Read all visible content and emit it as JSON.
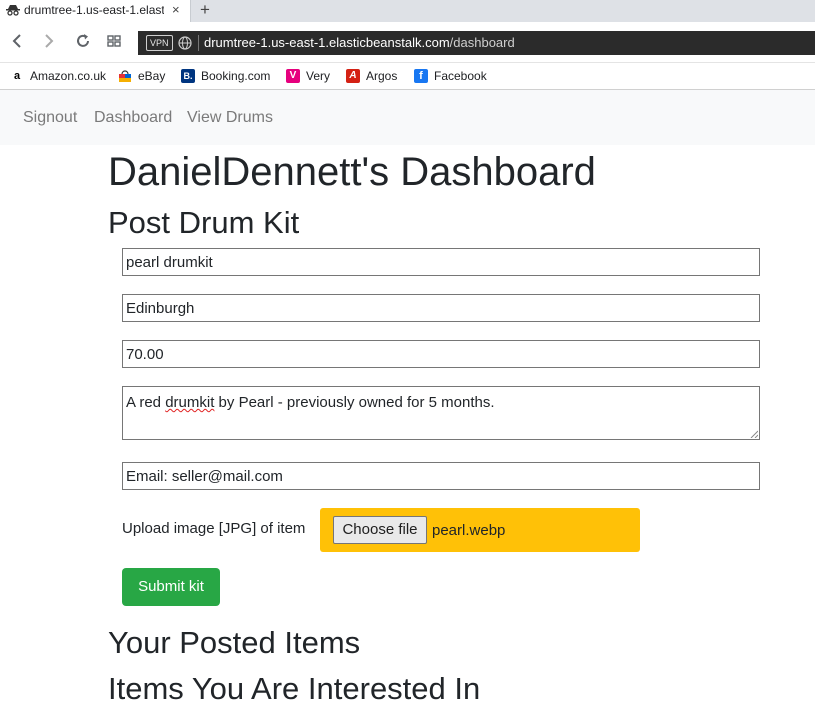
{
  "browser": {
    "tab_title": "drumtree-1.us-east-1.elast",
    "tab_close": "×",
    "new_tab": "+",
    "vpn_label": "VPN",
    "url_host": "drumtree-1.us-east-1.elasticbeanstalk.com",
    "url_path": "/dashboard",
    "bookmarks": [
      {
        "label": "Amazon.co.uk",
        "icon": "amazon-icon",
        "glyph": "a",
        "color": "#000000"
      },
      {
        "label": "eBay",
        "icon": "ebay-icon",
        "glyph": "",
        "color": "#e53238"
      },
      {
        "label": "Booking.com",
        "icon": "booking-icon",
        "glyph": "B.",
        "color": "#003580"
      },
      {
        "label": "Very",
        "icon": "very-icon",
        "glyph": "V",
        "color": "#e6007e"
      },
      {
        "label": "Argos",
        "icon": "argos-icon",
        "glyph": "A",
        "color": "#d42114"
      },
      {
        "label": "Facebook",
        "icon": "facebook-icon",
        "glyph": "f",
        "color": "#1877f2"
      }
    ]
  },
  "nav": {
    "signout": "Signout",
    "dashboard": "Dashboard",
    "view_drums": "View Drums"
  },
  "page": {
    "title": "DanielDennett's Dashboard",
    "post_heading": "Post Drum Kit",
    "posted_heading": "Your Posted Items",
    "interested_heading": "Items You Are Interested In"
  },
  "form": {
    "name_value": "pearl drumkit",
    "location_value": "Edinburgh",
    "price_value": "70.00",
    "description_word1": "A red ",
    "description_word2": "drumkit",
    "description_rest": " by Pearl - previously owned for 5 months.",
    "email_value": "Email: seller@mail.com",
    "upload_label": "Upload image [JPG] of item",
    "choose_file_label": "Choose file",
    "file_name": "pearl.webp",
    "submit_label": "Submit kit"
  },
  "colors": {
    "upload_highlight": "#ffc107",
    "submit_button": "#28a745"
  }
}
